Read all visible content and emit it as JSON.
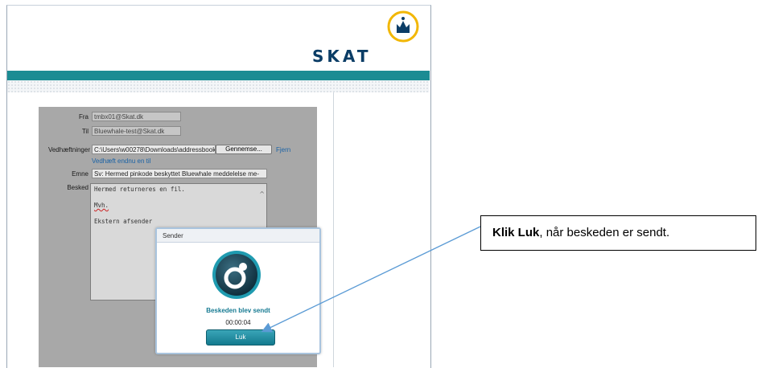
{
  "header": {
    "brand": "SKAT"
  },
  "form": {
    "fra_label": "Fra",
    "fra_value": "tmbx01@Skat.dk",
    "til_label": "Til",
    "til_value": "Bluewhale-test@Skat.dk",
    "vedhaeftninger_label": "Vedhæftninger",
    "vedhaeftninger_value": "C:\\Users\\w00278\\Downloads\\addressbook (",
    "browse_label": "Gennemse...",
    "fjern_label": "Fjern",
    "vedhaeft_mere_label": "Vedhæft endnu en til",
    "emne_label": "Emne",
    "emne_value": "Sv: Hermed pinkode beskyttet Bluewhale meddelelse me-",
    "besked_label": "Besked",
    "besked_lines": [
      "Hermed returneres en fil.",
      "",
      "Mvh.",
      "",
      "Ekstern afsender"
    ]
  },
  "dialog": {
    "title": "Sender",
    "status": "Beskeden blev sendt",
    "elapsed": "00:00:04",
    "close_label": "Luk"
  },
  "callout": {
    "bold": "Klik Luk",
    "rest": ", når beskeden er sendt."
  },
  "colors": {
    "teal": "#1b8c93",
    "brand_navy": "#0b3d66",
    "panel_gray": "#a8a8a8",
    "accent_blue": "#5b9bd5"
  }
}
